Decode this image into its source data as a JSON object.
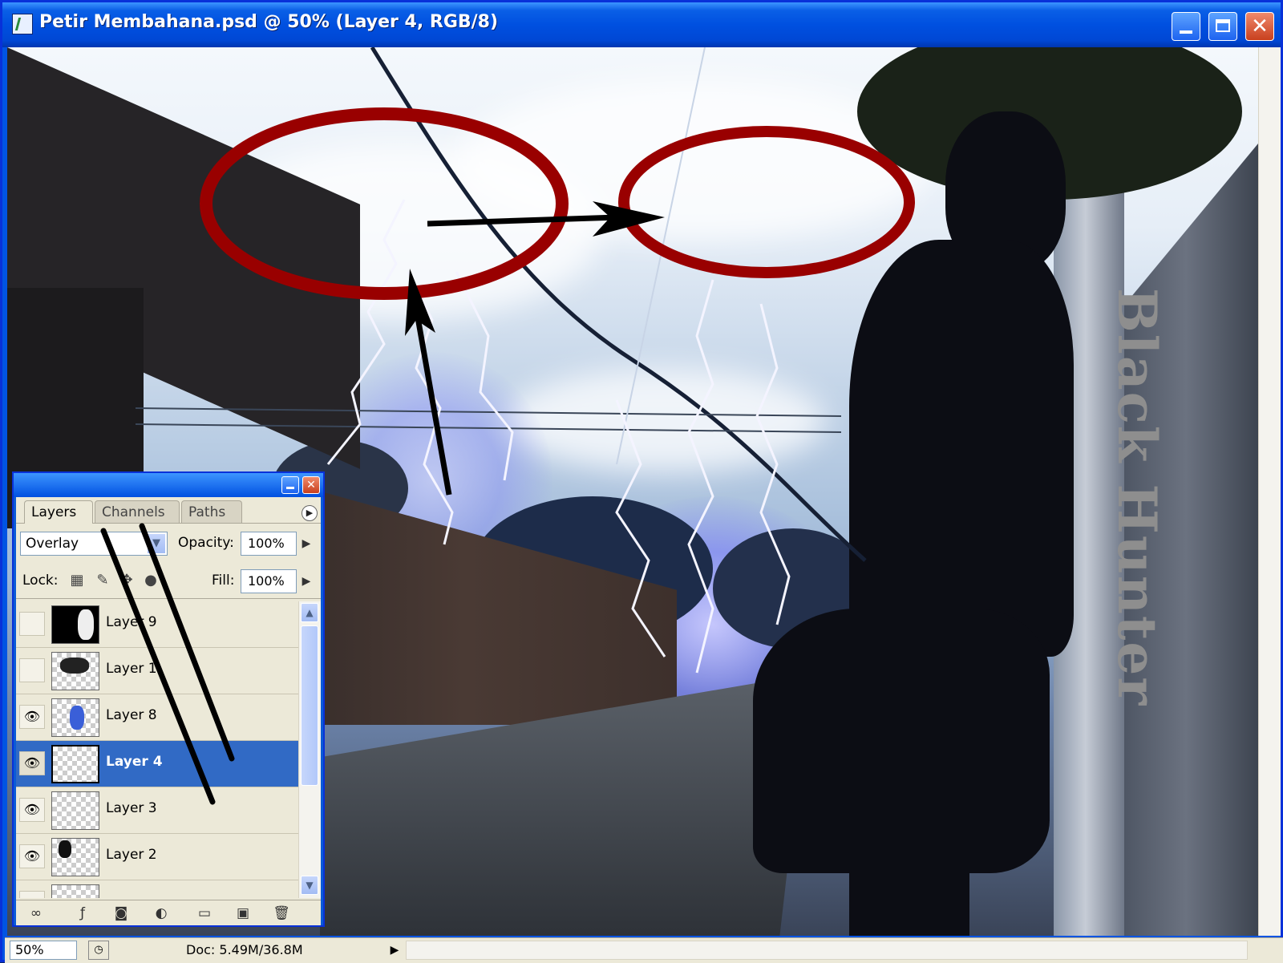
{
  "window": {
    "title": "Petir Membahana.psd @ 50% (Layer 4, RGB/8)",
    "close_glyph": "✕"
  },
  "canvas": {
    "watermark": "Black Hunter",
    "annotation_color": "#990000"
  },
  "layers_panel": {
    "close_glyph": "✕",
    "tabs": [
      {
        "label": "Layers",
        "active": true
      },
      {
        "label": "Channels",
        "active": false
      },
      {
        "label": "Paths",
        "active": false
      }
    ],
    "blend_mode": "Overlay",
    "opacity_label": "Opacity:",
    "opacity_value": "100%",
    "lock_label": "Lock:",
    "fill_label": "Fill:",
    "fill_value": "100%",
    "layers": [
      {
        "name": "Layer 9",
        "visible": false,
        "selected": false
      },
      {
        "name": "Layer 1",
        "visible": false,
        "selected": false
      },
      {
        "name": "Layer 8",
        "visible": true,
        "selected": false
      },
      {
        "name": "Layer 4",
        "visible": true,
        "selected": true
      },
      {
        "name": "Layer 3",
        "visible": true,
        "selected": false
      },
      {
        "name": "Layer 2",
        "visible": true,
        "selected": false
      }
    ],
    "eye_glyph": "👁"
  },
  "statusbar": {
    "zoom": "50%",
    "doc_info": "Doc: 5.49M/36.8M"
  }
}
